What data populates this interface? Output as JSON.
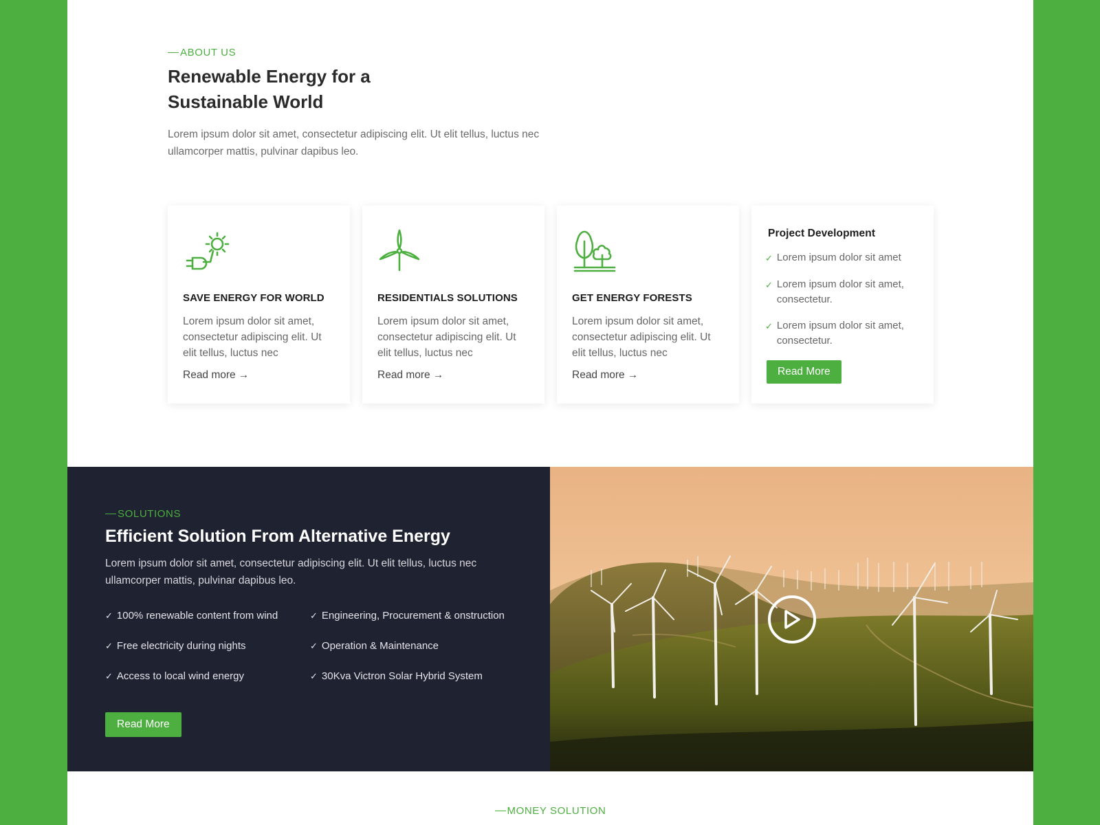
{
  "about": {
    "eyebrow": "ABOUT US",
    "title": "Renewable Energy for a Sustainable World",
    "lead": "Lorem ipsum dolor sit amet, consectetur adipiscing elit. Ut elit tellus, luctus nec ullamcorper mattis, pulvinar dapibus leo."
  },
  "cards": [
    {
      "icon": "solar-plug-icon",
      "title": "SAVE ENERGY FOR WORLD",
      "text": "Lorem ipsum dolor sit amet, consectetur adipiscing elit. Ut elit tellus, luctus nec",
      "link": "Read more"
    },
    {
      "icon": "wind-turbine-icon",
      "title": "RESIDENTIALS SOLUTIONS",
      "text": "Lorem ipsum dolor sit amet, consectetur adipiscing elit. Ut elit tellus, luctus nec",
      "link": "Read more"
    },
    {
      "icon": "trees-icon",
      "title": "GET ENERGY FORESTS",
      "text": "Lorem ipsum dolor sit amet, consectetur adipiscing elit. Ut elit tellus, luctus nec",
      "link": "Read more"
    }
  ],
  "project": {
    "title": "Project Development",
    "items": [
      "Lorem ipsum dolor sit amet",
      "Lorem ipsum dolor sit amet, consectetur.",
      "Lorem ipsum dolor sit amet, consectetur."
    ],
    "button": "Read More"
  },
  "solutions": {
    "eyebrow": "SOLUTIONS",
    "title": "Efficient Solution From Alternative Energy",
    "lead": "Lorem ipsum dolor sit amet, consectetur adipiscing elit. Ut elit tellus, luctus nec ullamcorper mattis, pulvinar dapibus leo.",
    "features": [
      "100% renewable content from wind",
      "Engineering, Procurement & onstruction",
      "Free electricity during nights",
      "Operation & Maintenance",
      "Access to local wind  energy",
      "30Kva Victron Solar Hybrid System"
    ],
    "button": "Read More",
    "video_icon": "play-icon"
  },
  "money": {
    "eyebrow": "MONEY SOLUTION"
  },
  "colors": {
    "accent": "#4caf3f",
    "dark_panel": "#1f2230",
    "frame": "#4caf3f"
  }
}
